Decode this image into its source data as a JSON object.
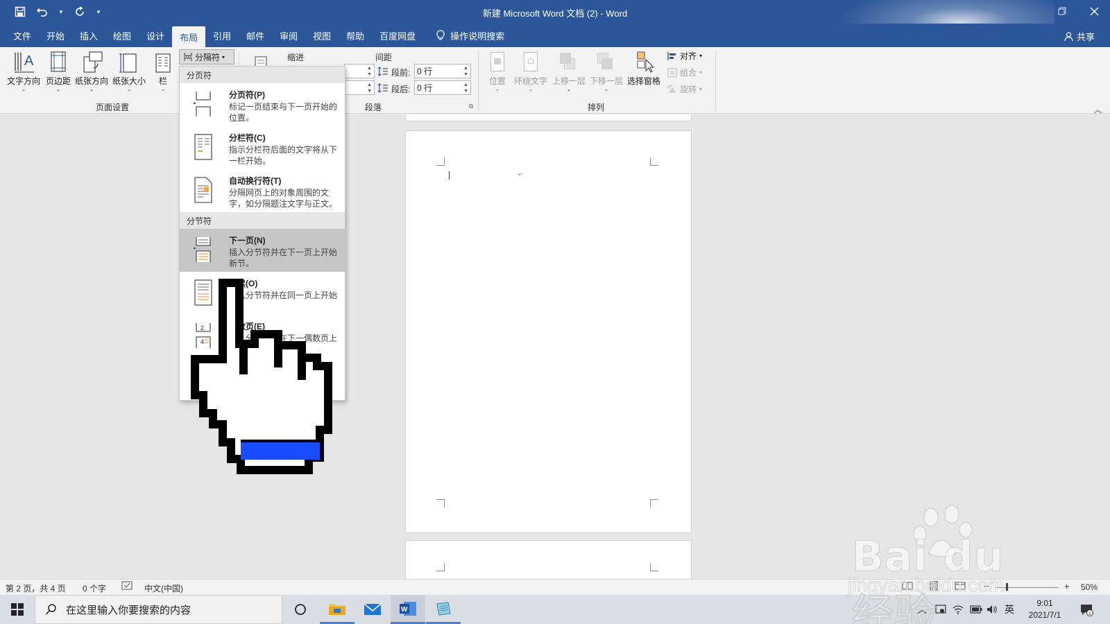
{
  "window": {
    "title": "新建 Microsoft Word 文档 (2)  -  Word",
    "colors": {
      "ribbon_blue": "#2b579a",
      "highlight": "#c6c6c6",
      "cursor_blue": "#1a4cff"
    }
  },
  "qat": {
    "save": "save-icon",
    "undo": "undo-icon",
    "redo": "redo-icon",
    "customize": "▾"
  },
  "tabs": [
    "文件",
    "开始",
    "插入",
    "绘图",
    "设计",
    "布局",
    "引用",
    "邮件",
    "审阅",
    "视图",
    "帮助",
    "百度网盘"
  ],
  "active_tab": "布局",
  "tell_me": "操作说明搜索",
  "share": "共享",
  "ribbon": {
    "page_setup": {
      "label": "页面设置",
      "buttons": [
        "文字方向",
        "页边距",
        "纸张方向",
        "纸张大小",
        "栏"
      ],
      "breaks": "分隔符"
    },
    "paragraph": {
      "label": "段落",
      "indent_label": "缩进",
      "spacing_label": "间距",
      "before_label": "段前:",
      "before_value": "0 行",
      "after_label": "段后:",
      "after_value": "0 行"
    },
    "arrange": {
      "label": "排列",
      "buttons": [
        "位置",
        "环绕文字",
        "上移一层",
        "下移一层",
        "选择窗格"
      ],
      "align": "对齐",
      "group": "组合",
      "rotate": "旋转"
    }
  },
  "breaks_menu": {
    "page_breaks_header": "分页符",
    "section_breaks_header": "分节符",
    "items": [
      {
        "title": "分页符(P)",
        "desc": "标记一页结束与下一页开始的位置。"
      },
      {
        "title": "分栏符(C)",
        "desc": "指示分栏符后面的文字将从下一栏开始。"
      },
      {
        "title": "自动换行符(T)",
        "desc": "分隔网页上的对象周围的文字，如分隔题注文字与正文。"
      },
      {
        "title": "下一页(N)",
        "desc": "插入分节符并在下一页上开始新节。"
      },
      {
        "title": "连续(O)",
        "desc": "插入分节符并在同一页上开始"
      },
      {
        "title": "偶数页(E)",
        "desc": "插入分节符并在下一偶数页上"
      }
    ],
    "highlighted_index": 3
  },
  "statusbar": {
    "page": "第 2 页，共 4 页",
    "words": "0 个字",
    "language": "中文(中国)",
    "zoom": "50%"
  },
  "taskbar": {
    "search_placeholder": "在这里输入你要搜索的内容",
    "ime": "英",
    "time": "9:01",
    "date": "2021/7/1"
  },
  "watermark": {
    "brand": "Bai du 经验",
    "url": "jingyan.baidu.com"
  }
}
